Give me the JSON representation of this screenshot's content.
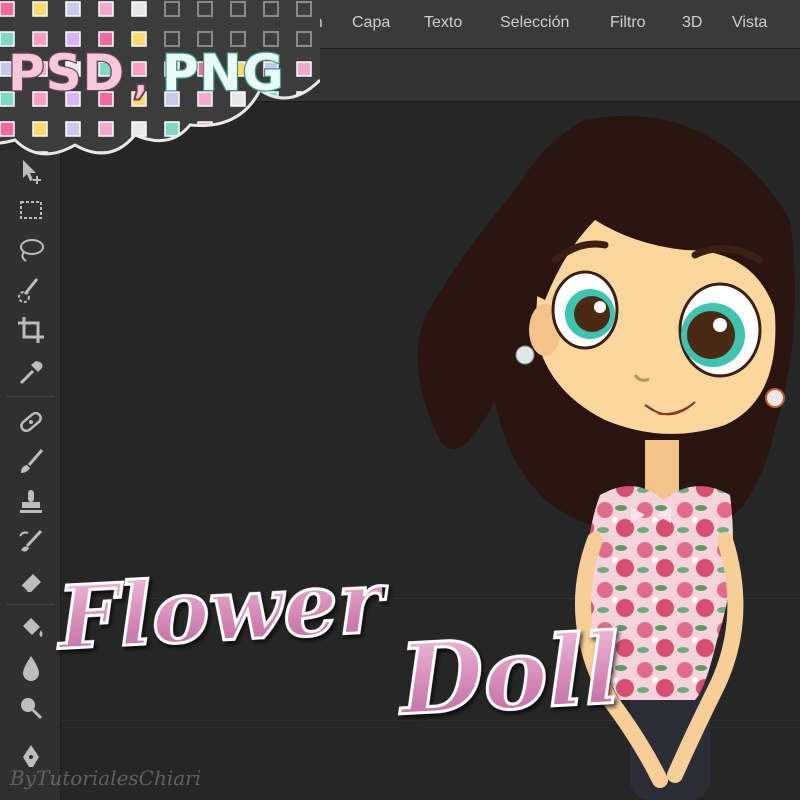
{
  "app": {
    "menu": [
      "gen",
      "Capa",
      "Texto",
      "Selección",
      "Filtro",
      "3D",
      "Vista"
    ]
  },
  "badges": {
    "psd": "PSD",
    "comma": ",",
    "png": "PNG"
  },
  "title": {
    "word1": "Flower",
    "word2": "Doll"
  },
  "credit": "ByTutorialesChiari",
  "colors": {
    "title_pink": "#d68ab8",
    "psd_pink": "#f7c7de",
    "png_mint": "#eafaf6",
    "hair": "#2a1410",
    "eye_teal": "#3ec4b0",
    "skin": "#fbd79e",
    "ui_dark": "#282828"
  },
  "toolbar": {
    "tools": [
      "move-tool",
      "marquee-tool",
      "lasso-tool",
      "quick-selection-tool",
      "crop-tool",
      "eyedropper-tool",
      "healing-brush-tool",
      "brush-tool",
      "clone-stamp-tool",
      "history-brush-tool",
      "eraser-tool",
      "paint-bucket-tool",
      "blur-tool",
      "dodge-tool",
      "pen-tool"
    ]
  }
}
